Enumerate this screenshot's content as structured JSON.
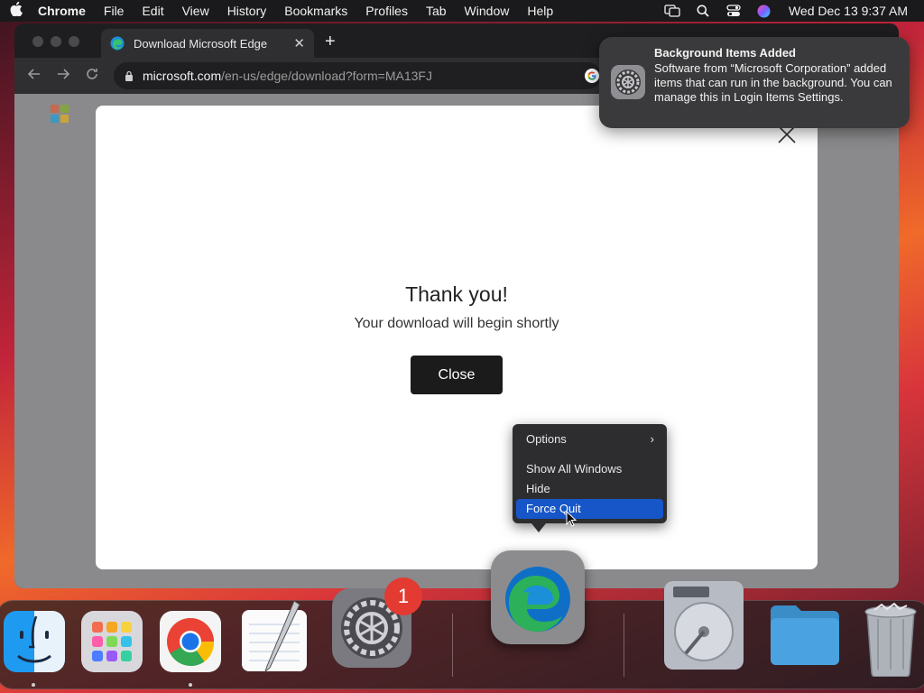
{
  "menubar": {
    "app": "Chrome",
    "items": [
      "File",
      "Edit",
      "View",
      "History",
      "Bookmarks",
      "Profiles",
      "Tab",
      "Window",
      "Help"
    ],
    "clock": "Wed Dec 13  9:37 AM"
  },
  "browser": {
    "tab_title": "Download Microsoft Edge",
    "url_host": "microsoft.com",
    "url_path": "/en-us/edge/download?form=MA13FJ"
  },
  "modal": {
    "heading": "Thank you!",
    "subtext": "Your download will begin shortly",
    "close_label": "Close"
  },
  "notification": {
    "title": "Background Items Added",
    "body": "Software from “Microsoft Corporation” added items that can run in the background. You can manage this in Login Items Settings."
  },
  "context_menu": {
    "items": [
      {
        "label": "Options",
        "submenu": true
      },
      {
        "label": "Show All Windows"
      },
      {
        "label": "Hide"
      },
      {
        "label": "Force Quit",
        "selected": true
      }
    ]
  },
  "dock": {
    "apps": [
      "Finder",
      "Launchpad",
      "Google Chrome",
      "TextEdit",
      "System Settings",
      "Microsoft Edge",
      "Disk Utility",
      "Folder",
      "Trash"
    ],
    "settings_badge": "1"
  },
  "colors": {
    "accent": "#1656c8",
    "badge": "#e33a32",
    "close_button": "#1b1b1b"
  }
}
